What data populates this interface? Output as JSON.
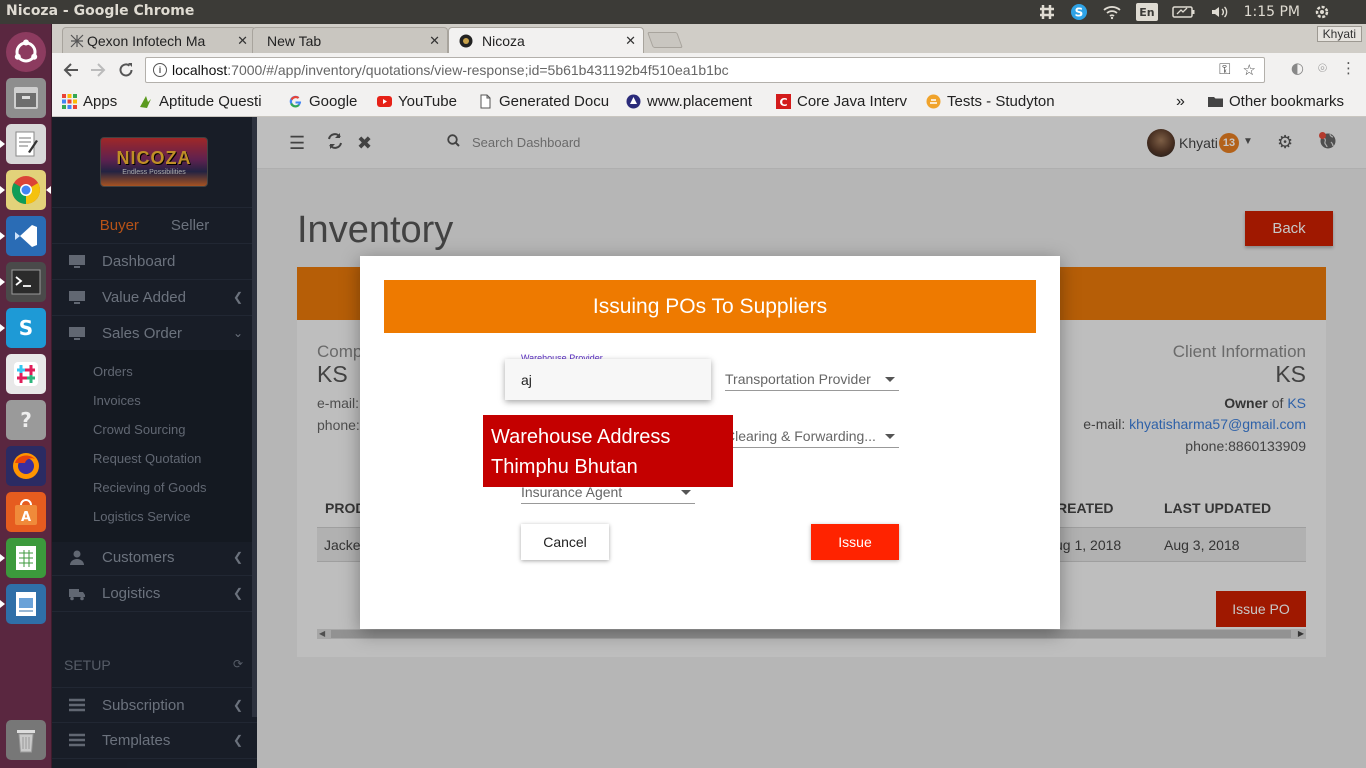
{
  "os": {
    "window_title": "Nicoza - Google Chrome",
    "input_lang": "En",
    "clock": "1:15 PM",
    "tray_icons": [
      "settings-hash-icon",
      "skype-icon",
      "wifi-icon",
      "keyboard-lang",
      "battery-icon",
      "volume-icon"
    ]
  },
  "launcher": {
    "apps": [
      "ubuntu-dash-icon",
      "files-icon",
      "text-editor-icon",
      "chrome-icon",
      "vscode-icon",
      "terminal-icon",
      "skype-icon",
      "slack-icon",
      "help-icon",
      "firefox-icon",
      "software-center-icon",
      "spreadsheet-icon",
      "impress-icon",
      "trash-icon"
    ]
  },
  "browser": {
    "profile": "Khyati",
    "tabs": [
      {
        "title": "Qexon Infotech Ma",
        "active": false
      },
      {
        "title": "New Tab",
        "active": false
      },
      {
        "title": "Nicoza",
        "active": true
      }
    ],
    "url_host": "localhost",
    "url_path": ":7000/#/app/inventory/quotations/view-response;id=5b61b431192b4f510ea1b1bc",
    "bookmarks": [
      {
        "label": "Apps",
        "icon": "apps-grid-icon"
      },
      {
        "label": "Aptitude Questi",
        "icon": "aptitude-icon"
      },
      {
        "label": "Google",
        "icon": "google-icon"
      },
      {
        "label": "YouTube",
        "icon": "youtube-icon"
      },
      {
        "label": "Generated Docu",
        "icon": "document-icon"
      },
      {
        "label": "www.placement",
        "icon": "placement-icon"
      },
      {
        "label": "Core Java Interv",
        "icon": "corejava-icon"
      },
      {
        "label": "Tests - Studyton",
        "icon": "studytonight-icon"
      }
    ],
    "more_bookmarks": "»",
    "other_bookmarks": "Other bookmarks"
  },
  "sidebar": {
    "logo_text": "NICOZA",
    "logo_tagline": "Endless Possibilities",
    "mode_tabs": {
      "buyer": "Buyer",
      "seller": "Seller"
    },
    "items": {
      "dashboard": "Dashboard",
      "value_added": "Value Added",
      "sales_order": "Sales Order",
      "customers": "Customers",
      "logistics": "Logistics"
    },
    "sub_items": [
      "Orders",
      "Invoices",
      "Crowd Sourcing",
      "Request Quotation",
      "Recieving of Goods",
      "Logistics Service"
    ],
    "setup_header": "SETUP",
    "setup_items": {
      "subscription": "Subscription",
      "templates": "Templates"
    }
  },
  "topnav": {
    "search_placeholder": "Search Dashboard",
    "user_name": "Khyati",
    "notification_count": "13"
  },
  "page": {
    "title": "Inventory",
    "back_label": "Back",
    "company_label": "Comp",
    "company_name": "KS",
    "email_label": "e-mail:",
    "phone_label": "phone:",
    "client_info": {
      "label": "Client Information",
      "name": "KS",
      "owner_prefix": "Owner",
      "owner_of": "of",
      "owner_link": "KS",
      "email_label": "e-mail:",
      "email": "khyatisharma57@gmail.com",
      "phone_label": "phone:",
      "phone": "8860133909"
    },
    "table": {
      "headers": {
        "product": "PROD",
        "created": "REATED",
        "last_updated": "LAST UPDATED"
      },
      "rows": [
        {
          "product": "Jacket",
          "created": "ug 1, 2018",
          "last_updated": "Aug 3, 2018"
        }
      ]
    },
    "issue_po_label": "Issue PO"
  },
  "modal": {
    "title": "Issuing POs To Suppliers",
    "warehouse_label": "Warehouse Provider",
    "warehouse_value": "aj",
    "transportation_placeholder": "Transportation Provider",
    "clearing_placeholder": "Clearing & Forwarding...",
    "insurance_placeholder": "Insurance Agent",
    "tooltip_line1": "Warehouse Address",
    "tooltip_line2": "Thimphu Bhutan",
    "cancel_label": "Cancel",
    "issue_label": "Issue"
  },
  "colors": {
    "accent_orange": "#ee7a00",
    "action_red": "#cc1f00",
    "issue_red": "#ff2300",
    "tooltip_red": "#c40000",
    "sidebar_bg": "#1f2633",
    "buyer_active": "#e96a1e"
  }
}
